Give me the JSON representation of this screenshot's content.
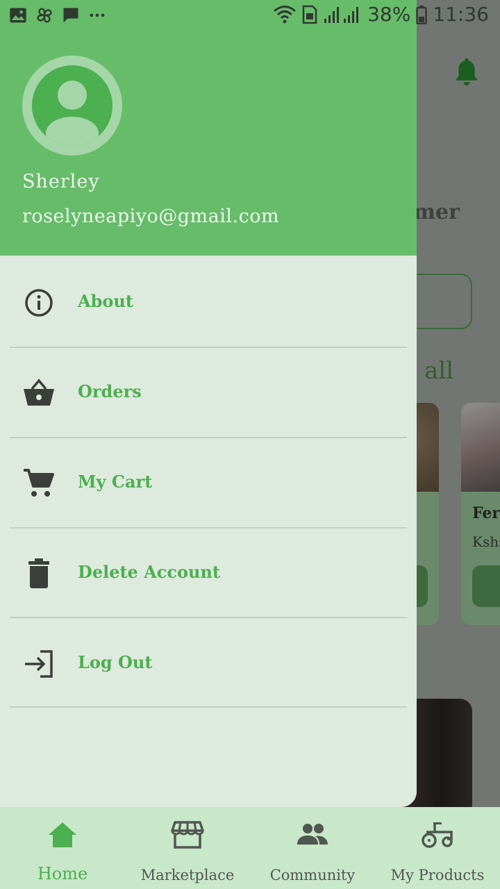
{
  "status_bar": {
    "battery": "38%",
    "time": "11:36",
    "left_icons": [
      "image-icon",
      "pinwheel-icon",
      "chat-icon",
      "more-dots-icon"
    ],
    "right_icons": [
      "wifi-icon",
      "sim-icon",
      "signal-icon",
      "signal-icon",
      "battery-icon"
    ]
  },
  "background": {
    "greeting_fragment": "armer",
    "see_all_fragment": "ee all",
    "product_name_fragment": "Fert",
    "product_price_fragment": "Kshs"
  },
  "drawer": {
    "user": {
      "name": "Sherley",
      "email": "roselyneapiyo@gmail.com"
    },
    "menu": [
      {
        "label": "About",
        "icon": "info-icon"
      },
      {
        "label": "Orders",
        "icon": "basket-icon"
      },
      {
        "label": "My Cart",
        "icon": "cart-icon"
      },
      {
        "label": "Delete Account",
        "icon": "trash-icon"
      },
      {
        "label": "Log Out",
        "icon": "logout-icon"
      }
    ]
  },
  "bottom_nav": [
    {
      "label": "Home",
      "icon": "home-icon",
      "active": true
    },
    {
      "label": "Marketplace",
      "icon": "store-icon",
      "active": false
    },
    {
      "label": "Community",
      "icon": "people-icon",
      "active": false
    },
    {
      "label": "My Products",
      "icon": "tractor-icon",
      "active": false
    }
  ],
  "colors": {
    "primary": "#4caf50",
    "header": "#67bc6a",
    "drawer_bg": "#deeadd",
    "nav_bg": "#c9e7c9"
  }
}
